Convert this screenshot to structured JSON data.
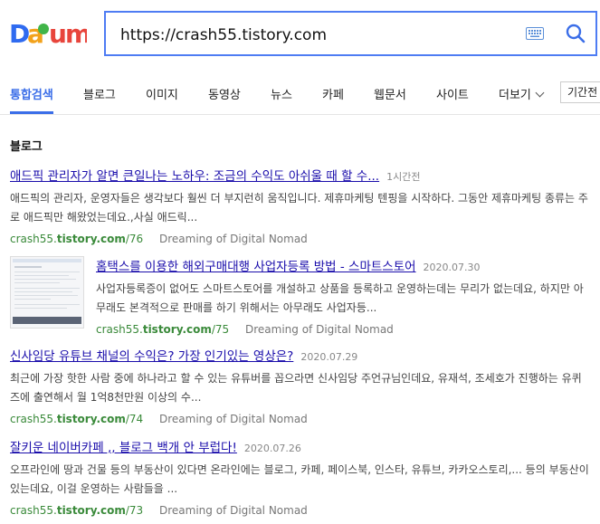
{
  "logo": {
    "text": "Daum",
    "colors": [
      "#2f6bf0",
      "#f2a21b",
      "#e8453c",
      "#41b549"
    ]
  },
  "search": {
    "value": "https://crash55.tistory.com",
    "accent": "#4e7cf3"
  },
  "icons": {
    "keyboard": "keyboard-icon",
    "search": "search-icon",
    "more": "chevron-down-icon"
  },
  "tabs": [
    {
      "label": "통합검색"
    },
    {
      "label": "블로그"
    },
    {
      "label": "이미지"
    },
    {
      "label": "동영상"
    },
    {
      "label": "뉴스"
    },
    {
      "label": "카페"
    },
    {
      "label": "웹문서"
    },
    {
      "label": "사이트"
    },
    {
      "label": "더보기"
    }
  ],
  "period_label": "기간전",
  "section_title": "블로그",
  "results": [
    {
      "title": "애드픽 관리자가 알면 큰일나는 노하우: 조금의 수익도 아쉬울 때 할 수...",
      "date": "1시간전",
      "desc": "애드픽의 관리자, 운영자들은 생각보다 훨씬 더 부지런히 움직입니다. 제휴마케팅 텐핑을 시작하다. 그동안 제휴마케팅 종류는 주로 애드픽만 해왔었는데요.,사실 애드릭...",
      "url_prefix": "crash55.",
      "url_domain": "tistory.com",
      "url_suffix": "/76",
      "blog": "Dreaming of Digital Nomad"
    },
    {
      "title": "홈택스를 이용한 해외구매대행 사업자등록 방법 - 스마트스토어",
      "date": "2020.07.30",
      "desc": "사업자등록증이 없어도 스마트스토어를 개설하고 상품을 등록하고 운영하는데는 무리가 없는데요, 하지만 아무래도 본격적으로 판매를 하기 위해서는 아무래도 사업자등...",
      "url_prefix": "crash55.",
      "url_domain": "tistory.com",
      "url_suffix": "/75",
      "blog": "Dreaming of Digital Nomad"
    },
    {
      "title": "신사임당 유튜브 채널의 수익은? 가장 인기있는 영상은?",
      "date": "2020.07.29",
      "desc": "최근에 가장 핫한 사람 중에 하나라고 할 수 있는 유튜버를 꼽으라면 신사임당 주언규님인데요, 유재석, 조세호가 진행하는 유퀴즈에 출연해서 월 1억8천만원 이상의 수...",
      "url_prefix": "crash55.",
      "url_domain": "tistory.com",
      "url_suffix": "/74",
      "blog": "Dreaming of Digital Nomad"
    },
    {
      "title": "잘키운 네이버카페 ,, 블로그 백개 안 부럽다!",
      "date": "2020.07.26",
      "desc": "오프라인에 땅과 건물 등의 부동산이 있다면 온라인에는 블로그, 카페, 페이스북, 인스타, 유튜브, 카카오스토리,... 등의 부동산이 있는데요, 이걸 운영하는 사람들을 ...",
      "url_prefix": "crash55.",
      "url_domain": "tistory.com",
      "url_suffix": "/73",
      "blog": "Dreaming of Digital Nomad"
    }
  ]
}
